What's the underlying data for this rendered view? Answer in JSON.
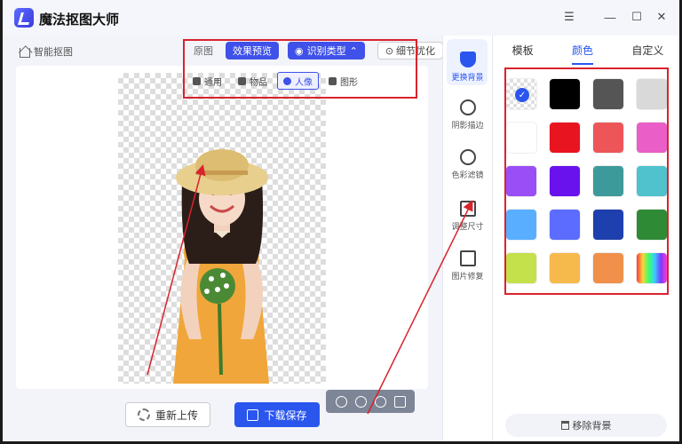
{
  "app": {
    "title": "魔法抠图大师"
  },
  "window": {
    "menu_icon": "menu-icon",
    "min_icon": "minimize-icon",
    "max_icon": "maximize-icon",
    "close_icon": "close-icon"
  },
  "workspace": {
    "smart_cut_label": "智能抠图",
    "view": {
      "original": "原图",
      "preview": "效果预览",
      "detect": "识别类型",
      "refine": "细节优化"
    },
    "types": [
      {
        "label": "通用",
        "icon": "navigation-icon"
      },
      {
        "label": "物品",
        "icon": "box-icon"
      },
      {
        "label": "人像",
        "icon": "person-icon"
      },
      {
        "label": "图形",
        "icon": "shapes-icon"
      }
    ],
    "reupload_label": "重新上传",
    "download_label": "下载保存"
  },
  "tools": [
    {
      "label": "更换背景",
      "icon": "paint-bucket-icon"
    },
    {
      "label": "阴影描边",
      "icon": "shadow-icon"
    },
    {
      "label": "色彩滤镜",
      "icon": "filter-icon"
    },
    {
      "label": "调整尺寸",
      "icon": "resize-icon"
    },
    {
      "label": "图片修复",
      "icon": "image-repair-icon"
    }
  ],
  "panel": {
    "tabs": [
      {
        "label": "模板"
      },
      {
        "label": "颜色"
      },
      {
        "label": "自定义"
      }
    ],
    "colors": [
      "transparent",
      "#000000",
      "#555555",
      "#d9d9d9",
      "#ffffff",
      "#e8141f",
      "#ee5558",
      "#ea5ec8",
      "#9a4ef5",
      "#6a12ee",
      "#3d9a9a",
      "#4fc2cd",
      "#5aaeff",
      "#5b6cff",
      "#1e3fae",
      "#2f8a35",
      "#c4e04a",
      "#f6b94b",
      "#f0904a",
      "rainbow"
    ],
    "remove_bg_label": "移除背景"
  },
  "accent": "#2a56ee",
  "annotation_color": "#d9232d"
}
